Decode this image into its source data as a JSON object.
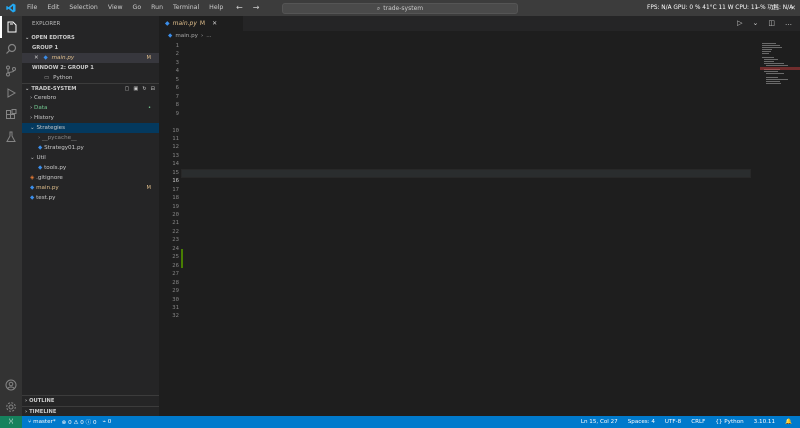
{
  "titlebar": {
    "menu": [
      "File",
      "Edit",
      "Selection",
      "View",
      "Go",
      "Run",
      "Terminal",
      "Help"
    ],
    "search": "trade-system",
    "perf": "FPS: N/A GPU: 0 % 41°C 11 W CPU: 11 % 功耗: N/A",
    "colors": {
      "bg": "#3c3c3c"
    }
  },
  "sidebar": {
    "title": "EXPLORER",
    "open_editors_header": "OPEN EDITORS",
    "group1_label": "GROUP 1",
    "group1_file": "main.py",
    "group1_file_badge": "M",
    "group2_label": "WINDOW 2: GROUP 1",
    "group2_item": "Python",
    "project_header": "TRADE-SYSTEM",
    "tree": [
      {
        "label": "Cerebro",
        "badge": ""
      },
      {
        "label": "Data",
        "badge": "•"
      },
      {
        "label": "History",
        "badge": ""
      },
      {
        "label": "Strategies",
        "badge": ""
      },
      {
        "label": "__pycache__",
        "badge": ""
      },
      {
        "label": "Strategy01.py",
        "badge": ""
      },
      {
        "label": "Util",
        "badge": ""
      },
      {
        "label": "tools.py",
        "badge": ""
      },
      {
        "label": ".gitignore",
        "badge": ""
      },
      {
        "label": "main.py",
        "badge": "M"
      },
      {
        "label": "test.py",
        "badge": ""
      }
    ],
    "outline_label": "OUTLINE",
    "timeline_label": "TIMELINE"
  },
  "tabs": {
    "active_name": "main.py",
    "active_badge": "M"
  },
  "breadcrumb": {
    "file": "main.py",
    "rest": "..."
  },
  "editor": {
    "line_numbers": [
      "1",
      "2",
      "3",
      "4",
      "5",
      "6",
      "7",
      "8",
      "9",
      "",
      "10",
      "11",
      "12",
      "13",
      "14",
      "15",
      "16",
      "17",
      "18",
      "19",
      "20",
      "21",
      "22",
      "23",
      "24",
      "25",
      "26",
      "27",
      "28",
      "29",
      "30",
      "31",
      "32"
    ],
    "current_line_index": 16
  },
  "statusbar": {
    "branch": "master*",
    "problems": "⊗ 0 ⚠ 0 ⓘ 0",
    "ports": "0",
    "position": "Ln 15, Col 27",
    "spaces": "Spaces: 4",
    "encoding": "UTF-8",
    "eol": "CRLF",
    "language": "{} Python",
    "version": "3.10.11"
  },
  "colors": {
    "accent": "#007acc",
    "modified": "#e2c08d",
    "editor_bg": "#1e1e1e",
    "sidebar_bg": "#252526"
  }
}
